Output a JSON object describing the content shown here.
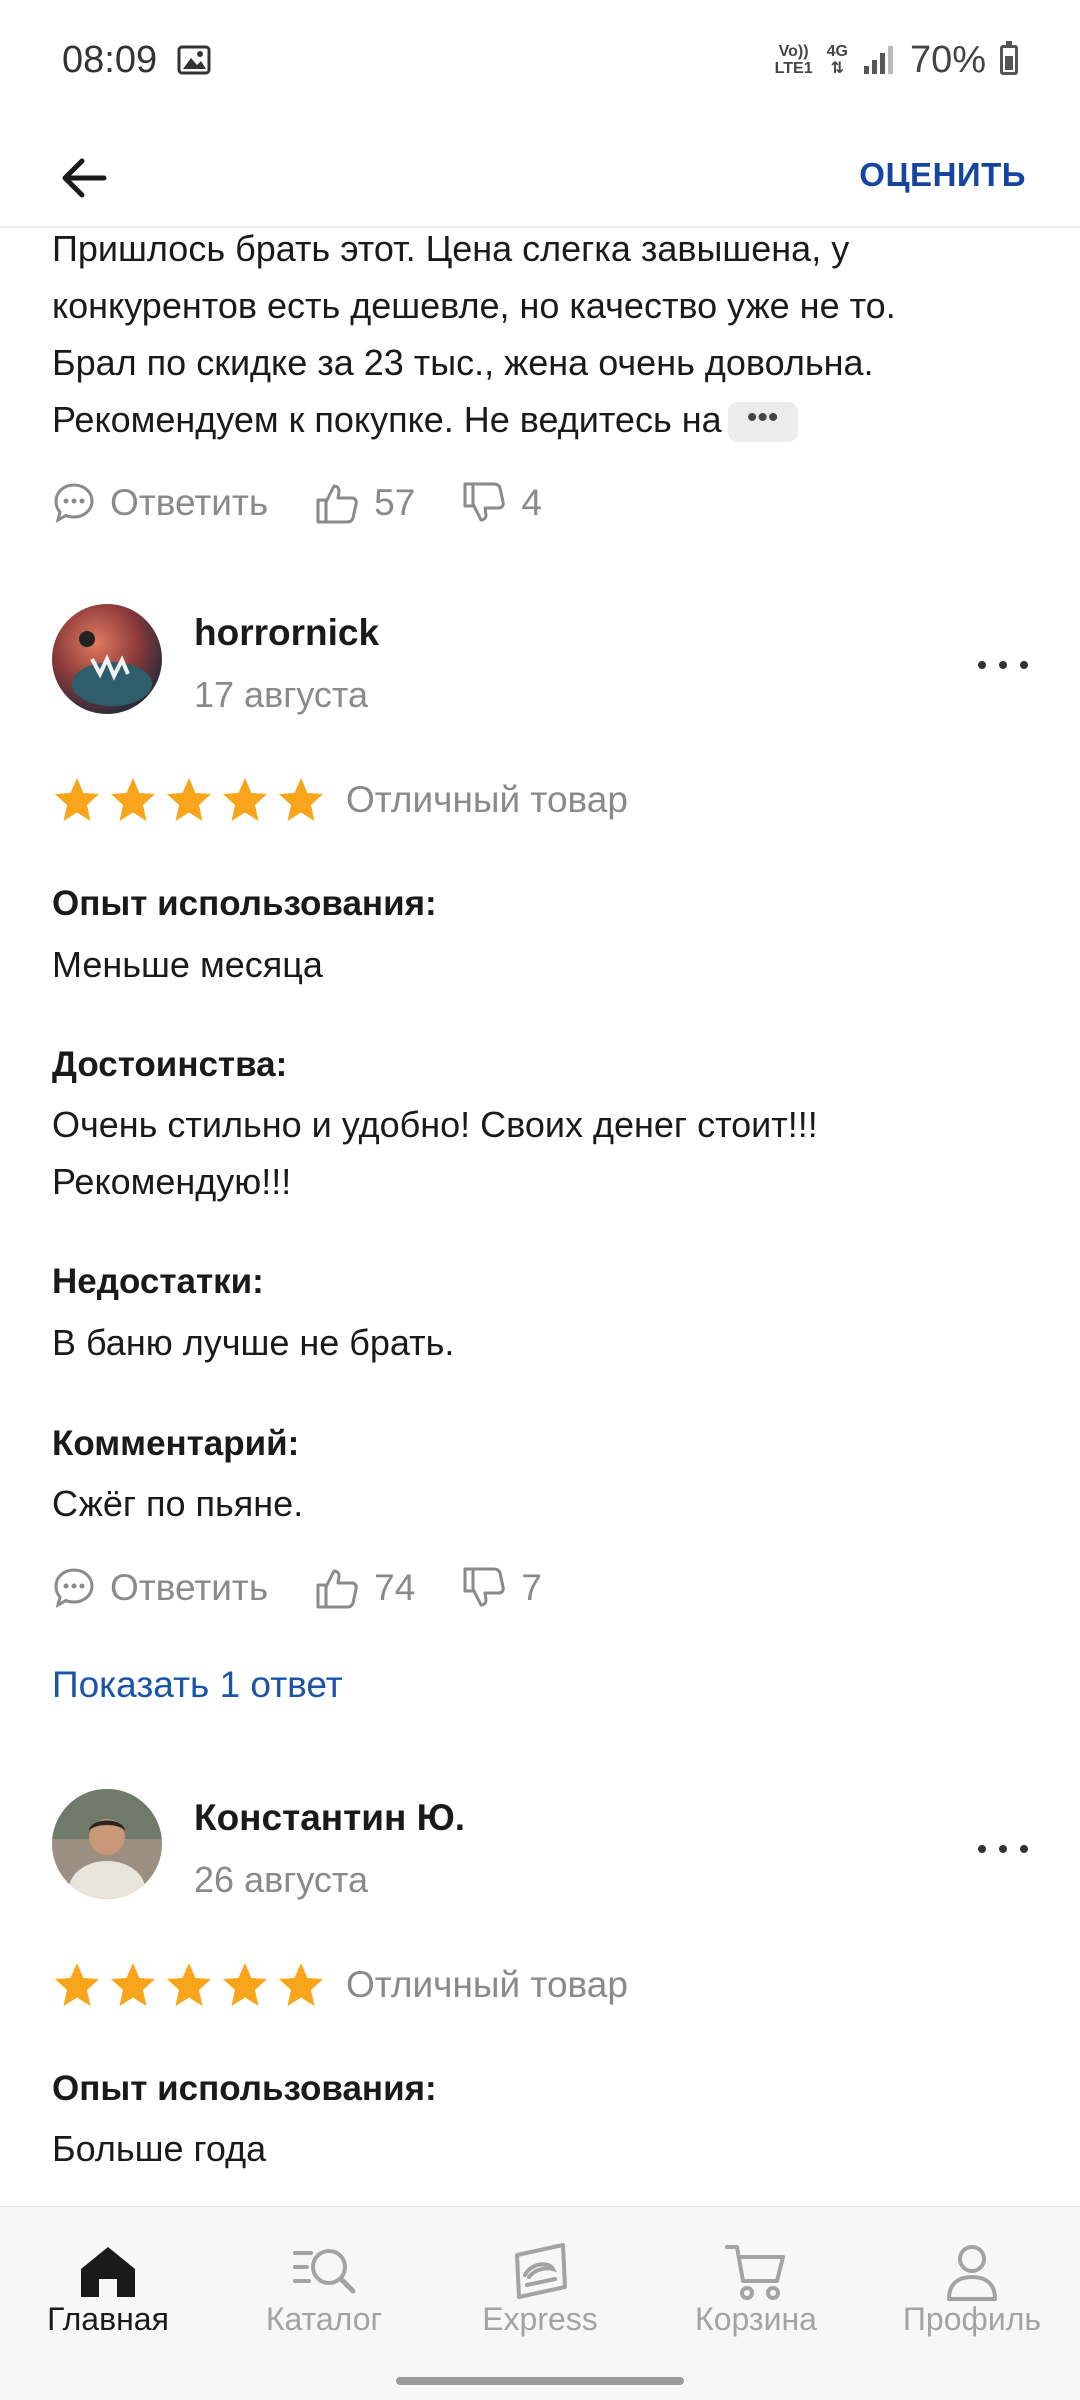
{
  "status_bar": {
    "time": "08:09",
    "net_top": "Vo))",
    "net_bottom": "LTE1",
    "net_type": "4G",
    "battery": "70%"
  },
  "app_bar": {
    "rate_label": "ОЦЕНИТЬ"
  },
  "review_prev": {
    "text_lines": [
      "Пришлось брать этот. Цена слегка завышена, у",
      "конкурентов есть дешевле, но качество уже не то.",
      "Брал по скидке за 23 тыс., жена очень довольна.",
      "Рекомендуем к покупке. Не ведитесь на"
    ],
    "more_label": "•••",
    "reply_label": "Ответить",
    "likes": "57",
    "dislikes": "4"
  },
  "review_1": {
    "author": "horrornick",
    "date": "17 августа",
    "rating": 5,
    "rating_label": "Отличный товар",
    "experience_title": "Опыт использования:",
    "experience": "Меньше месяца",
    "pros_title": "Достоинства:",
    "pros_lines": [
      "Очень стильно и удобно! Своих денег стоит!!!",
      "Рекомендую!!!"
    ],
    "cons_title": "Недостатки:",
    "cons": "В баню лучше не брать.",
    "comment_title": "Комментарий:",
    "comment": "Сжёг по пьяне.",
    "reply_label": "Ответить",
    "likes": "74",
    "dislikes": "7",
    "show_replies": "Показать 1 ответ"
  },
  "review_2": {
    "author": "Константин Ю.",
    "date": "26 августа",
    "rating": 5,
    "rating_label": "Отличный товар",
    "experience_title": "Опыт использования:",
    "experience": "Больше года"
  },
  "bottom_nav": [
    {
      "label": "Главная",
      "icon": "home-icon",
      "active": true
    },
    {
      "label": "Каталог",
      "icon": "catalog-search-icon",
      "active": false
    },
    {
      "label": "Express",
      "icon": "express-icon",
      "active": false
    },
    {
      "label": "Корзина",
      "icon": "cart-icon",
      "active": false
    },
    {
      "label": "Профиль",
      "icon": "profile-icon",
      "active": false
    }
  ],
  "colors": {
    "accent": "#1545a0",
    "link": "#1a53a8",
    "star": "#f8a51b",
    "muted": "#8a8a8a"
  }
}
